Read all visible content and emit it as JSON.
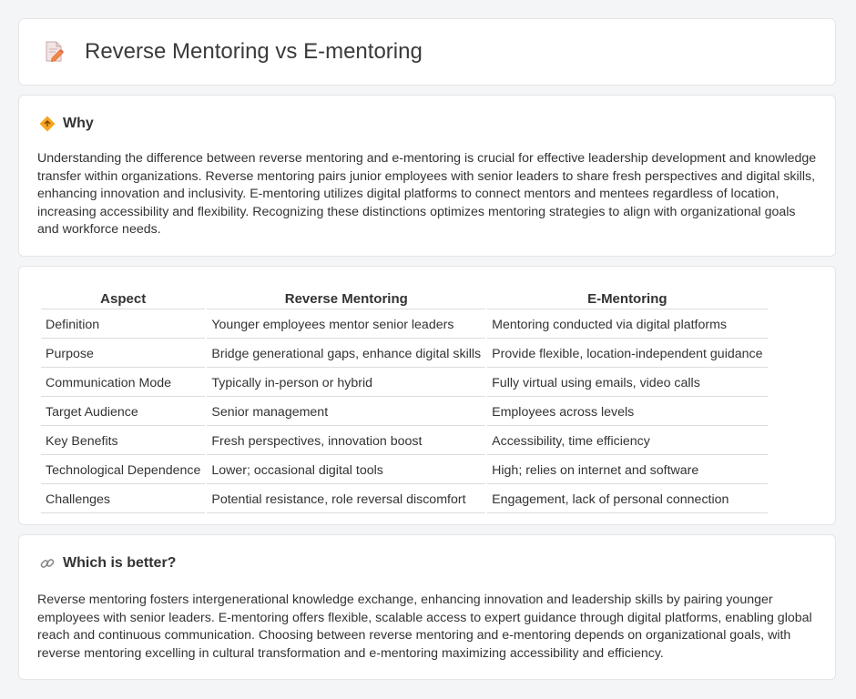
{
  "header": {
    "title": "Reverse Mentoring vs E-mentoring",
    "icon": "document-edit-icon"
  },
  "why": {
    "title": "Why",
    "icon": "diamond-signal-icon",
    "text": "Understanding the difference between reverse mentoring and e-mentoring is crucial for effective leadership development and knowledge transfer within organizations. Reverse mentoring pairs junior employees with senior leaders to share fresh perspectives and digital skills, enhancing innovation and inclusivity. E-mentoring utilizes digital platforms to connect mentors and mentees regardless of location, increasing accessibility and flexibility. Recognizing these distinctions optimizes mentoring strategies to align with organizational goals and workforce needs."
  },
  "table": {
    "headers": [
      "Aspect",
      "Reverse Mentoring",
      "E-Mentoring"
    ],
    "rows": [
      [
        "Definition",
        "Younger employees mentor senior leaders",
        "Mentoring conducted via digital platforms"
      ],
      [
        "Purpose",
        "Bridge generational gaps, enhance digital skills",
        "Provide flexible, location-independent guidance"
      ],
      [
        "Communication Mode",
        "Typically in-person or hybrid",
        "Fully virtual using emails, video calls"
      ],
      [
        "Target Audience",
        "Senior management",
        "Employees across levels"
      ],
      [
        "Key Benefits",
        "Fresh perspectives, innovation boost",
        "Accessibility, time efficiency"
      ],
      [
        "Technological Dependence",
        "Lower; occasional digital tools",
        "High; relies on internet and software"
      ],
      [
        "Challenges",
        "Potential resistance, role reversal discomfort",
        "Engagement, lack of personal connection"
      ]
    ]
  },
  "better": {
    "title": "Which is better?",
    "icon": "link-icon",
    "text": "Reverse mentoring fosters intergenerational knowledge exchange, enhancing innovation and leadership skills by pairing younger employees with senior leaders. E-mentoring offers flexible, scalable access to expert guidance through digital platforms, enabling global reach and continuous communication. Choosing between reverse mentoring and e-mentoring depends on organizational goals, with reverse mentoring excelling in cultural transformation and e-mentoring maximizing accessibility and efficiency."
  }
}
